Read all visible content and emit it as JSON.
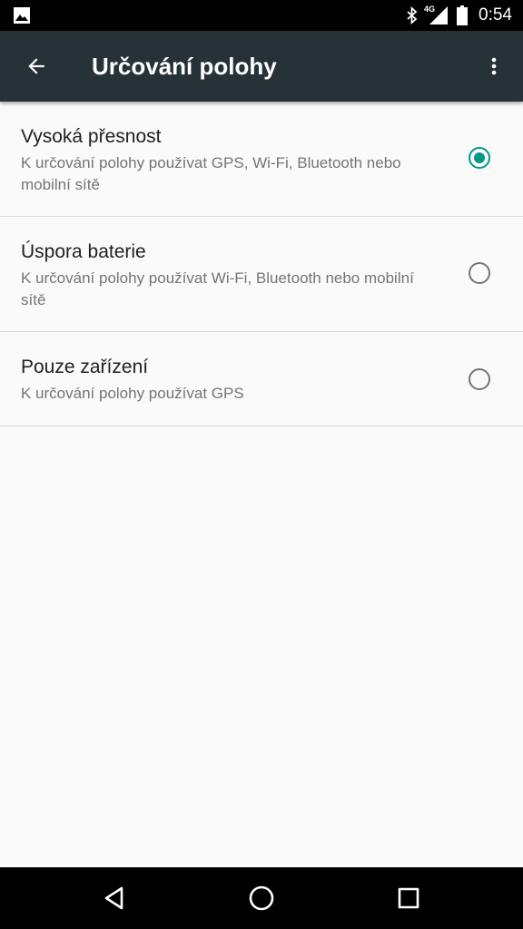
{
  "status_bar": {
    "time": "0:54",
    "network": "4G",
    "icons": [
      "gallery-icon",
      "bluetooth-icon",
      "signal-icon",
      "battery-icon"
    ]
  },
  "app_bar": {
    "title": "Určování polohy",
    "background": "#263238",
    "icons": [
      "back-arrow-icon",
      "more-vert-icon"
    ]
  },
  "options": [
    {
      "title": "Vysoká přesnost",
      "description": "K určování polohy používat GPS, Wi-Fi, Bluetooth nebo mobilní sítě",
      "selected": true
    },
    {
      "title": "Úspora baterie",
      "description": "K určování polohy používat Wi-Fi, Bluetooth nebo mobilní sítě",
      "selected": false
    },
    {
      "title": "Pouze zařízení",
      "description": "K určování polohy používat GPS",
      "selected": false
    }
  ],
  "accent_color": "#009688",
  "nav_bar": {
    "icons": [
      "back-triangle-icon",
      "home-circle-icon",
      "recents-square-icon"
    ]
  }
}
